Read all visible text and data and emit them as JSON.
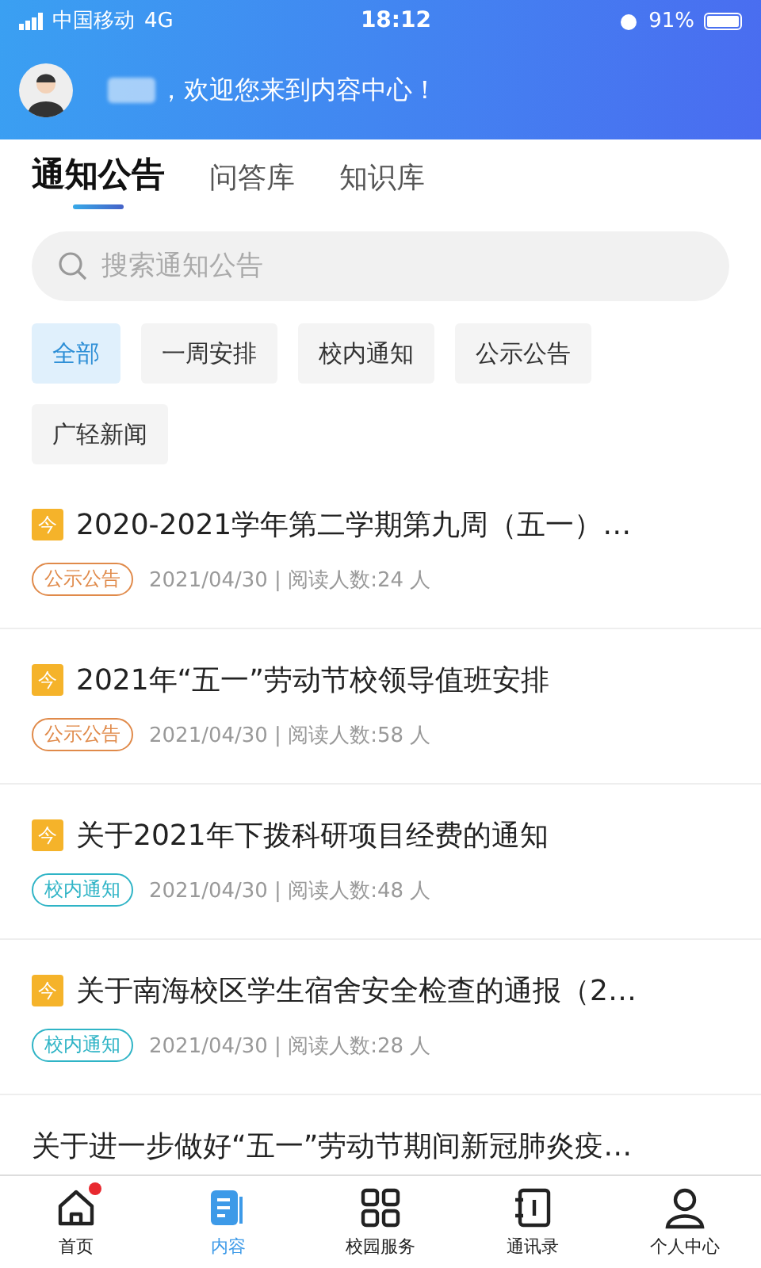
{
  "status_bar": {
    "carrier": "中国移动",
    "network": "4G",
    "time": "18:12",
    "battery": "91%"
  },
  "header": {
    "greeting": "，欢迎您来到内容中心！"
  },
  "tabs": [
    {
      "label": "通知公告",
      "selected": true
    },
    {
      "label": "问答库",
      "selected": false
    },
    {
      "label": "知识库",
      "selected": false
    }
  ],
  "search": {
    "placeholder": "搜索通知公告"
  },
  "filters": [
    {
      "label": "全部",
      "selected": true
    },
    {
      "label": "一周安排",
      "selected": false
    },
    {
      "label": "校内通知",
      "selected": false
    },
    {
      "label": "公示公告",
      "selected": false
    },
    {
      "label": "广轻新闻",
      "selected": false
    }
  ],
  "notices": [
    {
      "badge": "今",
      "title": "2020-2021学年第二学期第九周（五一）…",
      "tag": "公示公告",
      "color": "#e08a4a",
      "meta": "2021/04/30 | 阅读人数:24 人"
    },
    {
      "badge": "今",
      "title": "2021年“五一”劳动节校领导值班安排",
      "tag": "公示公告",
      "color": "#e08a4a",
      "meta": "2021/04/30 | 阅读人数:58 人"
    },
    {
      "badge": "今",
      "title": "关于2021年下拨科研项目经费的通知",
      "tag": "校内通知",
      "color": "#2fb4c6",
      "meta": "2021/04/30 | 阅读人数:48 人"
    },
    {
      "badge": "今",
      "title": "关于南海校区学生宿舍安全检查的通报（2…",
      "tag": "校内通知",
      "color": "#2fb4c6",
      "meta": "2021/04/30 | 阅读人数:28 人"
    },
    {
      "title": "关于进一步做好“五一”劳动节期间新冠肺炎疫…"
    }
  ],
  "bottom_nav": [
    {
      "label": "首页",
      "kind": "home",
      "selected": false,
      "unread": true
    },
    {
      "label": "内容",
      "kind": "content",
      "selected": true,
      "unread": false
    },
    {
      "label": "校园服务",
      "kind": "grid",
      "selected": false,
      "unread": false
    },
    {
      "label": "通讯录",
      "kind": "book",
      "selected": false,
      "unread": false
    },
    {
      "label": "个人中心",
      "kind": "person",
      "selected": false,
      "unread": false
    }
  ]
}
